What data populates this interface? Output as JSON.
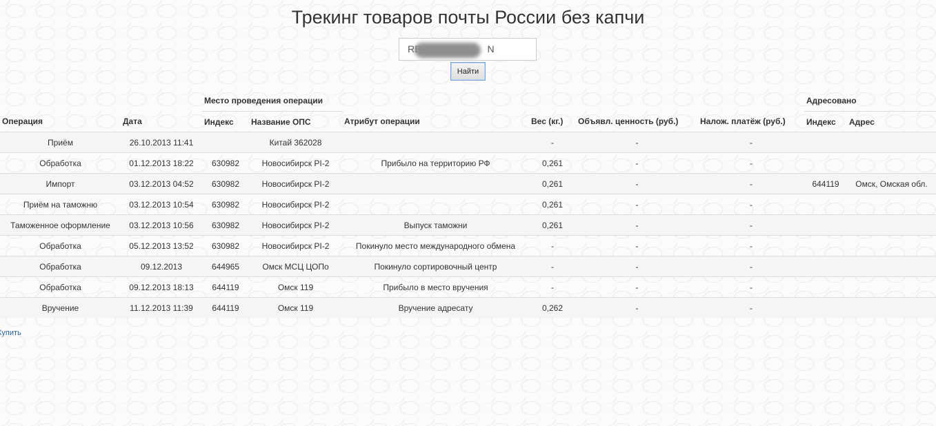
{
  "page": {
    "title": "Трекинг товаров почты России без капчи"
  },
  "search": {
    "value": "RB",
    "value_suffix": "N",
    "button_label": "Найти"
  },
  "table": {
    "group_headers": {
      "place": "Место проведения операции",
      "addressed": "Адресовано"
    },
    "columns": {
      "operation": "Операция",
      "date": "Дата",
      "index": "Индекс",
      "ops_name": "Название ОПС",
      "attribute": "Атрибут операции",
      "weight": "Вес (кг.)",
      "declared_value": "Объявл. ценность (руб.)",
      "cod": "Налож. платёж (руб.)",
      "addr_index": "Индекс",
      "address": "Адрес"
    },
    "rows": [
      {
        "operation": "Приём",
        "date": "26.10.2013 11:41",
        "index": "",
        "ops_name": "Китай 362028",
        "attribute": "",
        "weight": "-",
        "declared_value": "-",
        "cod": "-",
        "addr_index": "",
        "address": ""
      },
      {
        "operation": "Обработка",
        "date": "01.12.2013 18:22",
        "index": "630982",
        "ops_name": "Новосибирск PI-2",
        "attribute": "Прибыло на территорию РФ",
        "weight": "0,261",
        "declared_value": "-",
        "cod": "-",
        "addr_index": "",
        "address": ""
      },
      {
        "operation": "Импорт",
        "date": "03.12.2013 04:52",
        "index": "630982",
        "ops_name": "Новосибирск PI-2",
        "attribute": "",
        "weight": "0,261",
        "declared_value": "-",
        "cod": "-",
        "addr_index": "644119",
        "address": "Омск, Омская обл."
      },
      {
        "operation": "Приём на таможню",
        "date": "03.12.2013 10:54",
        "index": "630982",
        "ops_name": "Новосибирск PI-2",
        "attribute": "",
        "weight": "0,261",
        "declared_value": "-",
        "cod": "-",
        "addr_index": "",
        "address": ""
      },
      {
        "operation": "Таможенное оформление",
        "date": "03.12.2013 10:56",
        "index": "630982",
        "ops_name": "Новосибирск PI-2",
        "attribute": "Выпуск таможни",
        "weight": "0,261",
        "declared_value": "-",
        "cod": "-",
        "addr_index": "",
        "address": ""
      },
      {
        "operation": "Обработка",
        "date": "05.12.2013 13:52",
        "index": "630982",
        "ops_name": "Новосибирск PI-2",
        "attribute": "Покинуло место международного обмена",
        "weight": "-",
        "declared_value": "-",
        "cod": "-",
        "addr_index": "",
        "address": ""
      },
      {
        "operation": "Обработка",
        "date": "09.12.2013",
        "index": "644965",
        "ops_name": "Омск МСЦ ЦОПо",
        "attribute": "Покинуло сортировочный центр",
        "weight": "-",
        "declared_value": "-",
        "cod": "-",
        "addr_index": "",
        "address": ""
      },
      {
        "operation": "Обработка",
        "date": "09.12.2013 18:13",
        "index": "644119",
        "ops_name": "Омск 119",
        "attribute": "Прибыло в место вручения",
        "weight": "-",
        "declared_value": "-",
        "cod": "-",
        "addr_index": "",
        "address": ""
      },
      {
        "operation": "Вручение",
        "date": "11.12.2013 11:39",
        "index": "644119",
        "ops_name": "Омск 119",
        "attribute": "Вручение адресату",
        "weight": "0,262",
        "declared_value": "-",
        "cod": "-",
        "addr_index": "",
        "address": ""
      }
    ]
  },
  "footer": {
    "buy_link": "Купить"
  }
}
